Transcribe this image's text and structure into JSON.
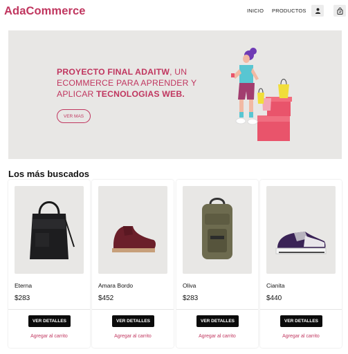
{
  "header": {
    "brand": "AdaCommerce",
    "nav": [
      {
        "label": "INICIO"
      },
      {
        "label": "PRODUCTOS"
      }
    ],
    "icons": [
      "user-icon",
      "cart-icon"
    ]
  },
  "hero": {
    "line_bold_1": "PROYECTO FINAL ADAITW",
    "line_normal_1": ", UN ECOMMERCE PARA APRENDER Y APLICAR ",
    "line_bold_2": "TECNOLOGIAS WEB.",
    "button": "VER MAS",
    "illustration": "woman-with-shopping-bags-illustration"
  },
  "section": {
    "title": "Los más buscados"
  },
  "products": [
    {
      "name": "Eterna",
      "price": "$283",
      "details_label": "VER DETALLES",
      "cart_label": "Agregar al carrito",
      "image": "black-bag"
    },
    {
      "name": "Amara Bordo",
      "price": "$452",
      "details_label": "VER DETALLES",
      "cart_label": "Agregar al carrito",
      "image": "burgundy-boot"
    },
    {
      "name": "Oliva",
      "price": "$283",
      "details_label": "VER DETALLES",
      "cart_label": "Agregar al carrito",
      "image": "olive-backpack"
    },
    {
      "name": "Cianita",
      "price": "$440",
      "details_label": "VER DETALLES",
      "cart_label": "Agregar al carrito",
      "image": "sneaker"
    }
  ],
  "colors": {
    "accent": "#c0365f",
    "hero_bg": "#e8e7e5",
    "button_dark": "#0b0b0b"
  }
}
